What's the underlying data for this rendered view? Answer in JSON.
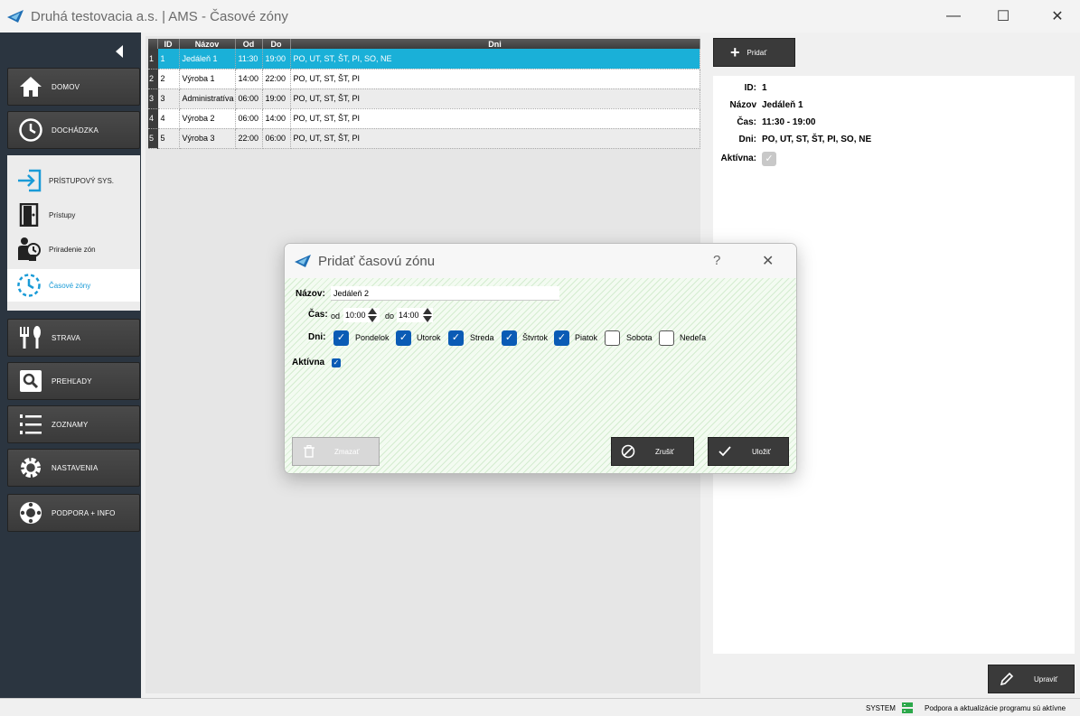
{
  "window": {
    "title": "Druhá testovacia a.s. | AMS - Časové zóny",
    "minimize_glyph": "—",
    "maximize_glyph": "☐",
    "close_glyph": "✕"
  },
  "sidebar": {
    "items": [
      {
        "label": "DOMOV",
        "icon": "home-icon"
      },
      {
        "label": "DOCHÁDZKA",
        "icon": "clock-icon"
      },
      {
        "label": "STRAVA",
        "icon": "cutlery-icon"
      },
      {
        "label": "PREHĽADY",
        "icon": "search-icon"
      },
      {
        "label": "ZOZNAMY",
        "icon": "list-icon"
      },
      {
        "label": "NASTAVENIA",
        "icon": "gear-icon"
      },
      {
        "label": "PODPORA + INFO",
        "icon": "lifebuoy-icon"
      }
    ],
    "subitems": [
      {
        "label": "PRÍSTUPOVÝ SYS.",
        "icon": "enter-icon"
      },
      {
        "label": "Prístupy",
        "icon": "door-icon"
      },
      {
        "label": "Priradenie zón",
        "icon": "person-clock-icon"
      },
      {
        "label": "Časové zóny",
        "icon": "time-zone-icon"
      }
    ]
  },
  "table": {
    "columns": [
      "ID",
      "Názov",
      "Od",
      "Do",
      "Dni"
    ],
    "rows": [
      {
        "rn": "1",
        "id": "1",
        "name": "Jedáleň 1",
        "from": "11:30",
        "to": "19:00",
        "days": "PO, UT, ST, ŠT, PI, SO, NE"
      },
      {
        "rn": "2",
        "id": "2",
        "name": "Výroba 1",
        "from": "14:00",
        "to": "22:00",
        "days": "PO, UT, ST, ŠT, PI"
      },
      {
        "rn": "3",
        "id": "3",
        "name": "Administratíva",
        "from": "06:00",
        "to": "19:00",
        "days": "PO, UT, ST, ŠT, PI"
      },
      {
        "rn": "4",
        "id": "4",
        "name": "Výroba 2",
        "from": "06:00",
        "to": "14:00",
        "days": "PO, UT, ST, ŠT, PI"
      },
      {
        "rn": "5",
        "id": "5",
        "name": "Výroba 3",
        "from": "22:00",
        "to": "06:00",
        "days": "PO, UT, ST, ŠT, PI"
      }
    ]
  },
  "panel": {
    "add_label": "Pridať",
    "edit_label": "Upraviť",
    "id_key": "ID:",
    "id_val": "1",
    "name_key": "Názov",
    "name_val": "Jedáleň 1",
    "time_key": "Čas:",
    "time_val": "11:30 - 19:00",
    "days_key": "Dni:",
    "days_val": "PO, UT, ST, ŠT, PI, SO, NE",
    "active_key": "Aktívna:",
    "active_checked": true
  },
  "dialog": {
    "title": "Pridať časovú zónu",
    "help_glyph": "?",
    "close_glyph": "✕",
    "name_label": "Názov:",
    "name_value": "Jedáleň 2",
    "time_label": "Čas:",
    "from_label": "od",
    "from_value": "10:00",
    "to_label": "do",
    "to_value": "14:00",
    "days_label": "Dni:",
    "days": [
      {
        "label": "Pondelok",
        "checked": true
      },
      {
        "label": "Utorok",
        "checked": true
      },
      {
        "label": "Streda",
        "checked": true
      },
      {
        "label": "Štvrtok",
        "checked": true
      },
      {
        "label": "Piatok",
        "checked": true
      },
      {
        "label": "Sobota",
        "checked": false
      },
      {
        "label": "Nedeľa",
        "checked": false
      }
    ],
    "active_label": "Aktívna",
    "active_checked": true,
    "delete_label": "Zmazať",
    "cancel_label": "Zrušiť",
    "save_label": "Uložiť"
  },
  "status": {
    "user": "SYSTEM",
    "message": "Podpora a aktualizácie programu sú aktívne"
  },
  "colors": {
    "selection": "#1ab0d8",
    "sidebar_bg": "#2b3540",
    "checkbox": "#0a5bb5",
    "active_sub": "#1a9bd7"
  }
}
